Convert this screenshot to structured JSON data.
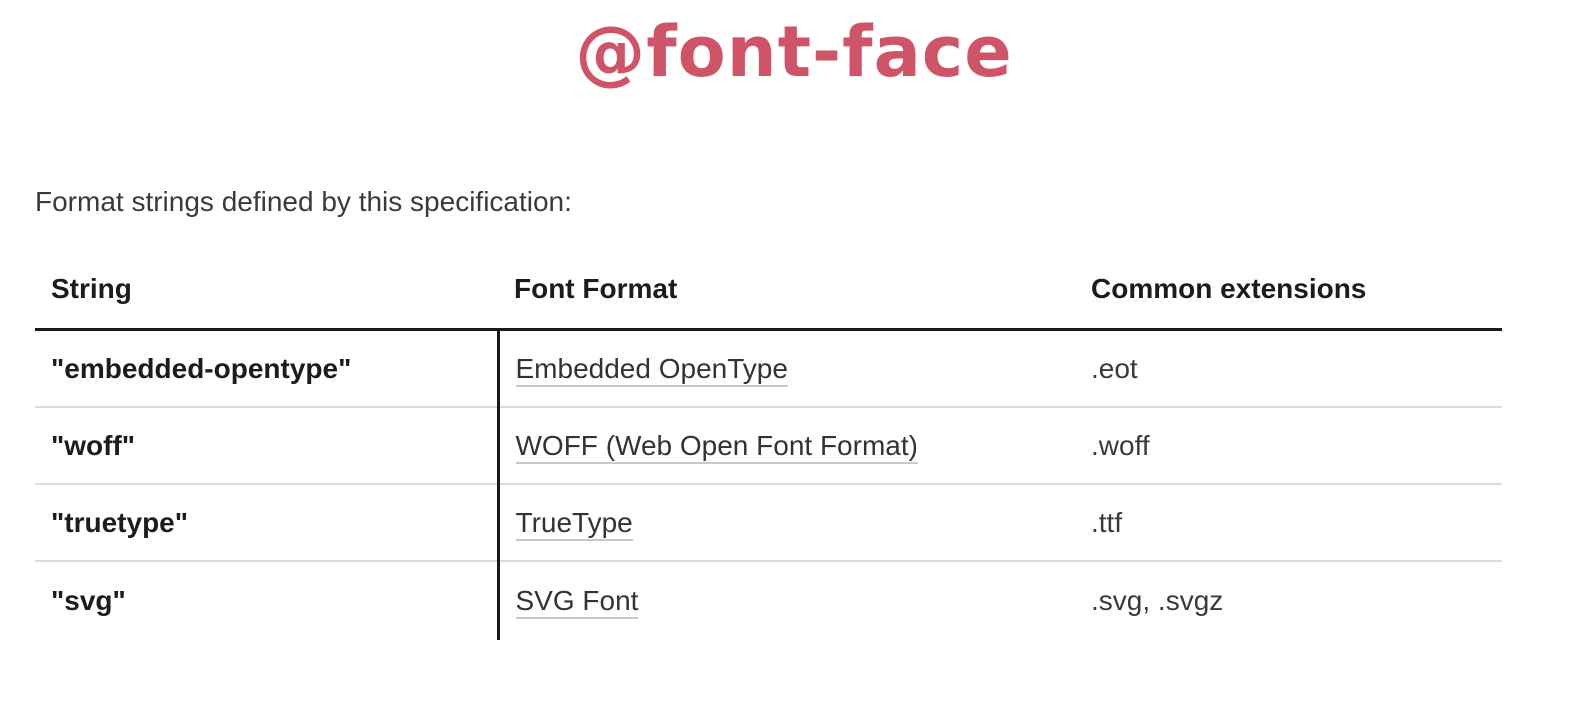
{
  "title": "@font-face",
  "intro": "Format strings defined by this specification:",
  "table": {
    "headers": {
      "string": "String",
      "font_format": "Font Format",
      "extensions": "Common extensions"
    },
    "rows": [
      {
        "string": "\"embedded-opentype\"",
        "font_format": "Embedded OpenType",
        "extensions": ".eot"
      },
      {
        "string": "\"woff\"",
        "font_format": "WOFF (Web Open Font Format)",
        "extensions": ".woff"
      },
      {
        "string": "\"truetype\"",
        "font_format": "TrueType",
        "extensions": ".ttf"
      },
      {
        "string": "\"svg\"",
        "font_format": "SVG Font",
        "extensions": ".svg, .svgz"
      }
    ]
  },
  "colors": {
    "title": "#cf5468",
    "text": "#333333",
    "rule": "#1a1a1a",
    "row_divider": "#dcdcdc"
  }
}
